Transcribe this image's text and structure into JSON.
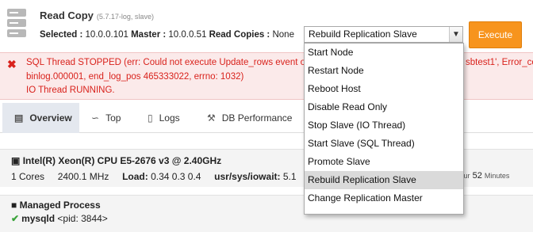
{
  "node": {
    "title": "Read Copy",
    "version": "(5.7.17-log, slave)",
    "selected_label": "Selected :",
    "selected_value": "10.0.0.101",
    "master_label": "Master :",
    "master_value": "10.0.0.51",
    "read_copies_label": "Read Copies :",
    "read_copies_value": "None"
  },
  "actions": {
    "selected_value": "Rebuild Replication Slave",
    "execute_label": "Execute",
    "options": [
      "Start Node",
      "Restart Node",
      "Reboot Host",
      "Disable Read Only",
      "Stop Slave (IO Thread)",
      "Start Slave (SQL Thread)",
      "Promote Slave",
      "Rebuild Replication Slave",
      "Change Replication Master"
    ]
  },
  "alert": {
    "line1_left": "SQL Thread STOPPED (err: Could not execute Update_rows event on ta",
    "line1_right": "sbtest1', Error_co",
    "line2": "binlog.000001, end_log_pos 465333022, errno: 1032)",
    "line3": "IO Thread RUNNING.",
    "color": "#d9221c"
  },
  "tabs": [
    {
      "label": "Overview",
      "icon": "overview-chart-icon"
    },
    {
      "label": "Top",
      "icon": "line-chart-icon"
    },
    {
      "label": "Logs",
      "icon": "logs-drive-icon"
    },
    {
      "label": "DB Performance",
      "icon": "wrench-icon"
    }
  ],
  "cpu": {
    "title": "Intel(R) Xeon(R) CPU E5-2676 v3 @ 2.40GHz",
    "cores": "1 Cores",
    "mhz": "2400.1 MHz",
    "load_label": "Load:",
    "load_value": "0.34 0.3 0.4",
    "iowait_label": "usr/sys/iowait:",
    "iowait_value": "5.1",
    "uptime_hour_word": "Hour",
    "uptime_minutes": "52",
    "uptime_minutes_word": "Minutes"
  },
  "process": {
    "title": "Managed Process",
    "name": "mysqld",
    "pid": "<pid: 3844>"
  },
  "colors": {
    "accent": "#f7941d",
    "ok": "#3aa33a",
    "tab_active_bg": "#e4e8ef"
  }
}
